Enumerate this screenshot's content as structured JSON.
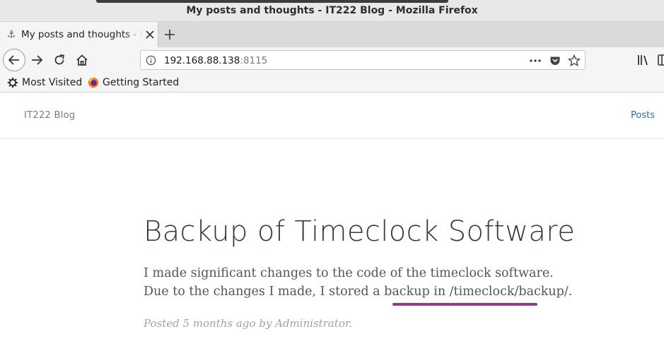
{
  "window": {
    "title": "My posts and thoughts - IT222 Blog - Mozilla Firefox"
  },
  "tab": {
    "label": "My posts and thoughts - IT222 Blog"
  },
  "urlbar": {
    "host": "192.168.88.138",
    "port": ":8115"
  },
  "bookmarks": [
    {
      "label": "Most Visited",
      "icon": "gear-icon"
    },
    {
      "label": "Getting Started",
      "icon": "firefox-icon"
    }
  ],
  "site": {
    "brand": "IT222 Blog",
    "nav_posts": "Posts"
  },
  "post": {
    "title": "Backup of Timeclock Software",
    "body": "I made significant changes to the code of the timeclock software. Due to the changes I made, I stored a backup in /timeclock/backup/.",
    "meta": "Posted 5 months ago by Administrator."
  },
  "colors": {
    "annotation_underline": "#8e3b8f",
    "link": "#2f6f9f"
  }
}
